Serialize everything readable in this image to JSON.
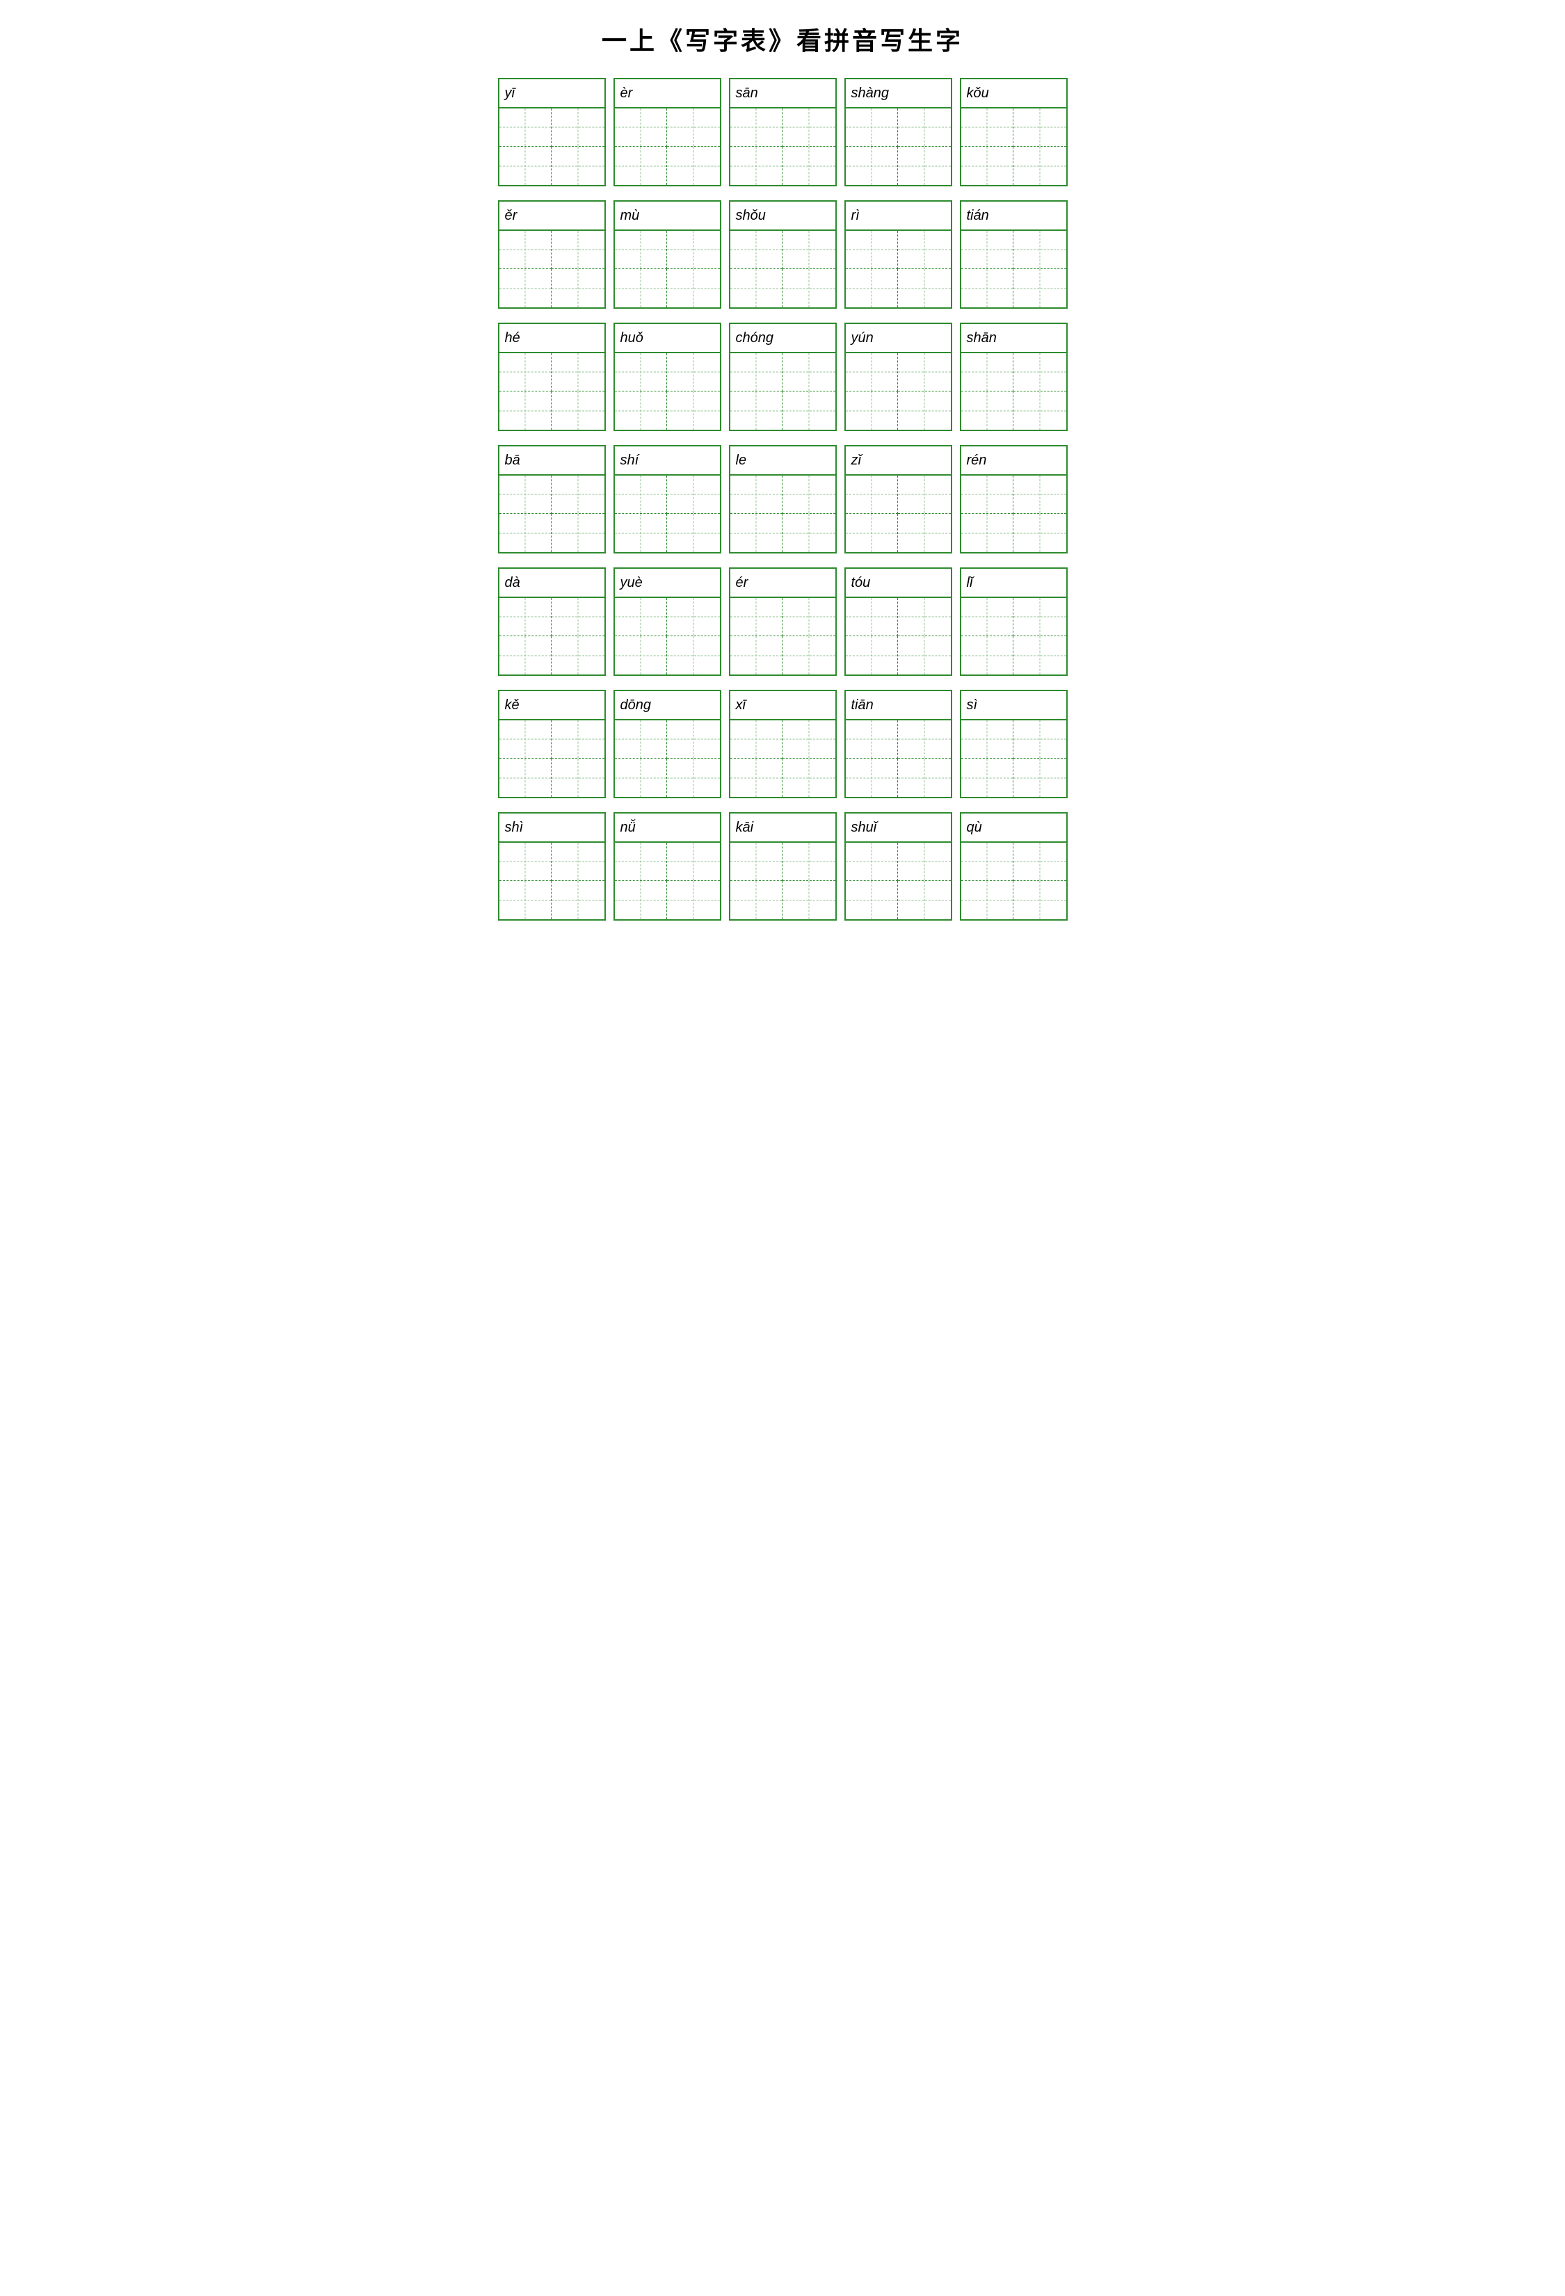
{
  "title": "一上《写字表》看拼音写生字",
  "rows": [
    [
      {
        "pinyin": "yī"
      },
      {
        "pinyin": "èr"
      },
      {
        "pinyin": "sān"
      },
      {
        "pinyin": "shàng"
      },
      {
        "pinyin": "kǒu"
      }
    ],
    [
      {
        "pinyin": "ěr"
      },
      {
        "pinyin": "mù"
      },
      {
        "pinyin": "shǒu"
      },
      {
        "pinyin": "rì"
      },
      {
        "pinyin": "tián"
      }
    ],
    [
      {
        "pinyin": "hé"
      },
      {
        "pinyin": "huǒ"
      },
      {
        "pinyin": "chóng"
      },
      {
        "pinyin": "yún"
      },
      {
        "pinyin": "shān"
      }
    ],
    [
      {
        "pinyin": "bā"
      },
      {
        "pinyin": "shí"
      },
      {
        "pinyin": "le"
      },
      {
        "pinyin": "zǐ"
      },
      {
        "pinyin": "rén"
      }
    ],
    [
      {
        "pinyin": "dà"
      },
      {
        "pinyin": "yuè"
      },
      {
        "pinyin": "ér"
      },
      {
        "pinyin": "tóu"
      },
      {
        "pinyin": "lǐ"
      }
    ],
    [
      {
        "pinyin": "kě"
      },
      {
        "pinyin": "dōng"
      },
      {
        "pinyin": "xī"
      },
      {
        "pinyin": "tiān"
      },
      {
        "pinyin": "sì"
      }
    ],
    [
      {
        "pinyin": "shì"
      },
      {
        "pinyin": "nǚ"
      },
      {
        "pinyin": "kāi"
      },
      {
        "pinyin": "shuǐ"
      },
      {
        "pinyin": "qù"
      }
    ]
  ]
}
